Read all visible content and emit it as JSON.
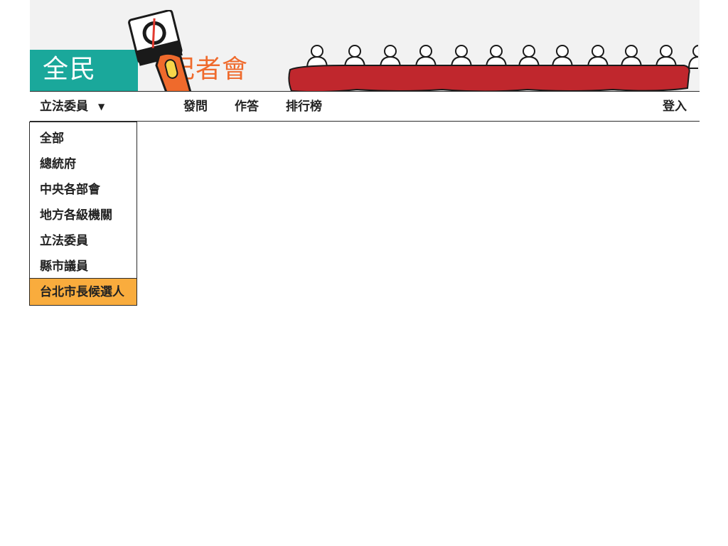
{
  "brand": {
    "part1": "全民",
    "part2": "記者會",
    "teal_color": "#1aa89b",
    "orange_color": "#ef6a2c",
    "table_color": "#c0272d",
    "mic_icon": "microphone-icon"
  },
  "nav": {
    "category_label": "立法委員",
    "caret": "▼",
    "ask_label": "發問",
    "answer_label": "作答",
    "ranking_label": "排行榜",
    "login_label": "登入"
  },
  "dropdown": {
    "items": [
      {
        "label": "全部"
      },
      {
        "label": "總統府"
      },
      {
        "label": "中央各部會"
      },
      {
        "label": "地方各級機關"
      },
      {
        "label": "立法委員"
      },
      {
        "label": "縣市議員"
      },
      {
        "label": "台北市長候選人"
      }
    ],
    "highlighted_index": 6,
    "highlight_color": "#f9ac3d"
  }
}
